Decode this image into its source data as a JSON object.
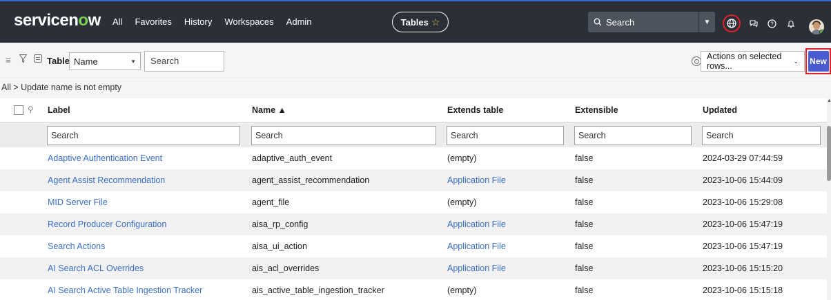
{
  "header": {
    "logo_text_a": "servicen",
    "logo_text_o": "o",
    "logo_text_b": "w",
    "nav": [
      "All",
      "Favorites",
      "History",
      "Workspaces",
      "Admin"
    ],
    "context_pill": "Tables",
    "search_placeholder": "Search"
  },
  "toolbar": {
    "title": "Tables",
    "field_selected": "Name",
    "search_placeholder": "Search",
    "actions_selected": "Actions on selected rows...",
    "new_label": "New"
  },
  "breadcrumb": "All > Update name is not empty",
  "table": {
    "columns": [
      "Label",
      "Name ▲",
      "Extends table",
      "Extensible",
      "Updated"
    ],
    "search_placeholder": "Search",
    "rows": [
      {
        "label": "Adaptive Authentication Event",
        "name": "adaptive_auth_event",
        "extends": "(empty)",
        "extends_link": false,
        "extensible": "false",
        "updated": "2024-03-29 07:44:59"
      },
      {
        "label": "Agent Assist Recommendation",
        "name": "agent_assist_recommendation",
        "extends": "Application File",
        "extends_link": true,
        "extensible": "false",
        "updated": "2023-10-06 15:44:09"
      },
      {
        "label": "MID Server File",
        "name": "agent_file",
        "extends": "(empty)",
        "extends_link": false,
        "extensible": "false",
        "updated": "2023-10-06 15:29:08"
      },
      {
        "label": "Record Producer Configuration",
        "name": "aisa_rp_config",
        "extends": "Application File",
        "extends_link": true,
        "extensible": "false",
        "updated": "2023-10-06 15:47:19"
      },
      {
        "label": "Search Actions",
        "name": "aisa_ui_action",
        "extends": "Application File",
        "extends_link": true,
        "extensible": "false",
        "updated": "2023-10-06 15:47:19"
      },
      {
        "label": "AI Search ACL Overrides",
        "name": "ais_acl_overrides",
        "extends": "Application File",
        "extends_link": true,
        "extensible": "false",
        "updated": "2023-10-06 15:15:20"
      },
      {
        "label": "AI Search Active Table Ingestion Tracker",
        "name": "ais_active_table_ingestion_tracker",
        "extends": "(empty)",
        "extends_link": false,
        "extensible": "false",
        "updated": "2023-10-06 15:15:18"
      }
    ]
  },
  "colors": {
    "header_bg": "#2b3038",
    "brand_green": "#79d24d",
    "link_blue": "#3a6ec7",
    "new_button": "#4a5ad1",
    "highlight_red": "#e0202a"
  },
  "icons": [
    "menu-icon",
    "filter-icon",
    "list-icon",
    "search-icon",
    "star-icon",
    "globe-icon",
    "chat-icon",
    "help-icon",
    "bell-icon",
    "gear-icon",
    "chevron-down-icon"
  ]
}
